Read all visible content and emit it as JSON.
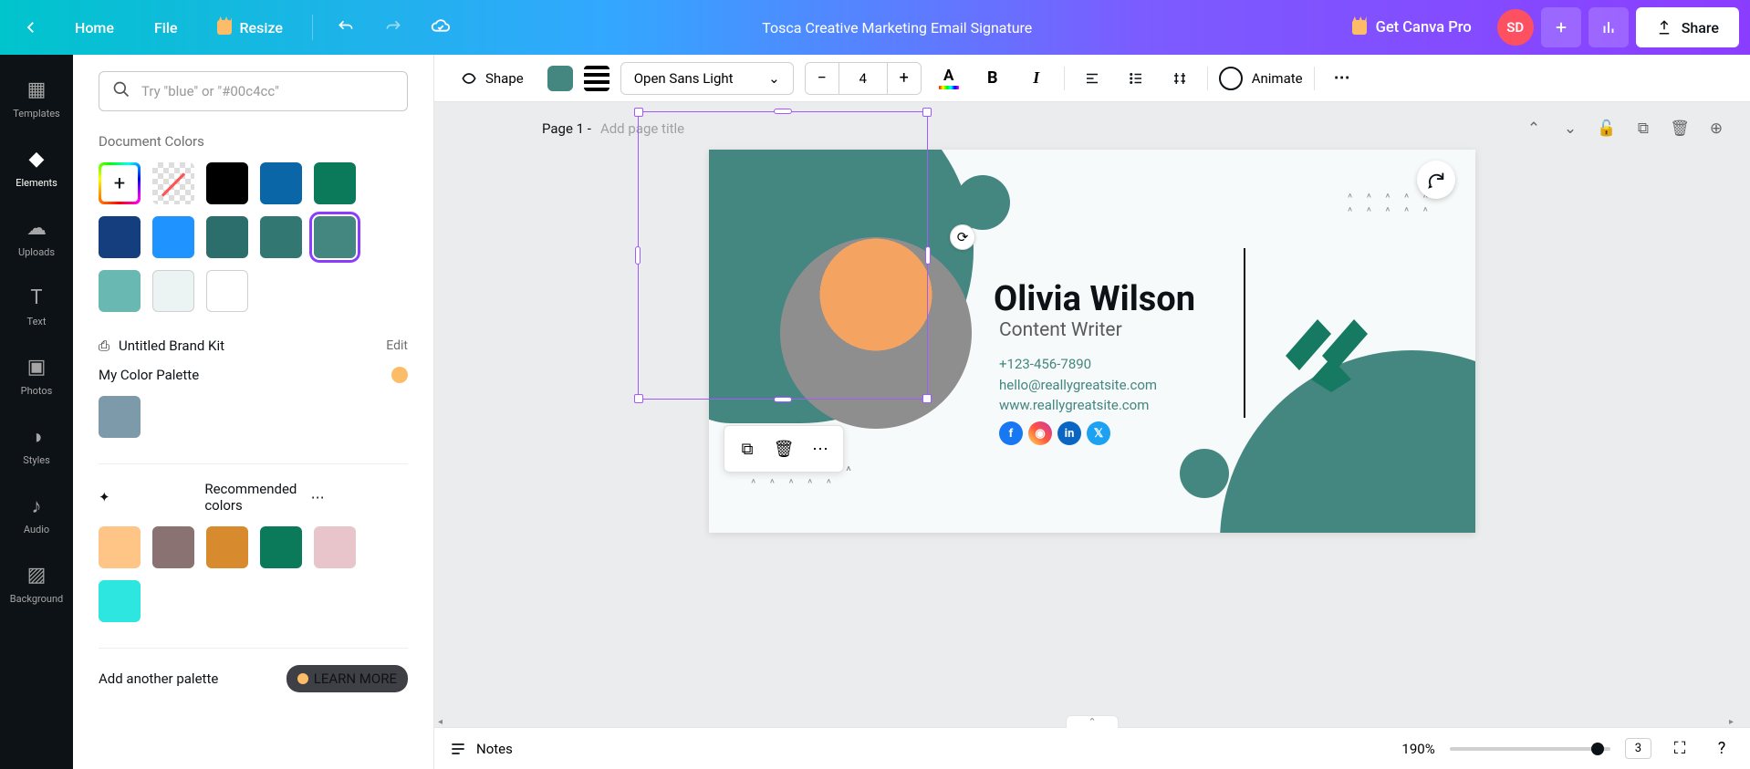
{
  "topbar": {
    "home": "Home",
    "file": "File",
    "resize": "Resize",
    "doc_title": "Tosca Creative Marketing Email Signature",
    "get_pro": "Get Canva Pro",
    "avatar_initials": "SD",
    "share": "Share"
  },
  "rail": [
    {
      "id": "templates",
      "label": "Templates"
    },
    {
      "id": "elements",
      "label": "Elements"
    },
    {
      "id": "uploads",
      "label": "Uploads"
    },
    {
      "id": "text",
      "label": "Text"
    },
    {
      "id": "photos",
      "label": "Photos"
    },
    {
      "id": "styles",
      "label": "Styles"
    },
    {
      "id": "audio",
      "label": "Audio"
    },
    {
      "id": "background",
      "label": "Background"
    }
  ],
  "panel": {
    "search_placeholder": "Try \"blue\" or \"#00c4cc\"",
    "doc_colors_h": "Document Colors",
    "doc_colors": [
      {
        "kind": "add"
      },
      {
        "kind": "none"
      },
      {
        "hex": "#000000"
      },
      {
        "hex": "#0a66a7"
      },
      {
        "hex": "#0a7a5a"
      },
      {
        "hex": "#153e7e"
      },
      {
        "hex": "#1f93ff"
      },
      {
        "hex": "#2c6e6b"
      },
      {
        "hex": "#337773"
      },
      {
        "hex": "#448680",
        "selected": true
      },
      {
        "hex": "#6ab8b2"
      },
      {
        "hex": "#ecf3f3",
        "bordered": true
      },
      {
        "hex": "#ffffff",
        "bordered": true
      }
    ],
    "brand_kit": "Untitled Brand Kit",
    "edit": "Edit",
    "palette_name": "My Color Palette",
    "palette_colors": [
      {
        "hex": "#7d9aab"
      }
    ],
    "rec_h": "Recommended colors",
    "rec_colors": [
      {
        "hex": "#ffc587"
      },
      {
        "hex": "#8a7272"
      },
      {
        "hex": "#d88a2e"
      },
      {
        "hex": "#0b7a5a"
      },
      {
        "hex": "#e7c5ca"
      },
      {
        "hex": "#2ee6e0"
      }
    ],
    "add_palette": "Add another palette",
    "learn_more": "LEARN MORE"
  },
  "ctx": {
    "shape": "Shape",
    "font": "Open Sans Light",
    "font_size": "4",
    "animate": "Animate"
  },
  "page_header": {
    "page_label": "Page 1 -",
    "title_placeholder": "Add page title"
  },
  "design": {
    "name": "Olivia Wilson",
    "role": "Content Writer",
    "phone": "+123-456-7890",
    "email": "hello@reallygreatsite.com",
    "web": "www.reallygreatsite.com",
    "socials": [
      {
        "bg": "#1877f2",
        "txt": "f"
      },
      {
        "bg": "linear-gradient(45deg,#fd5,#ff543e,#c837ab)",
        "txt": "◉"
      },
      {
        "bg": "#0a66c2",
        "txt": "in"
      },
      {
        "bg": "#1da1f2",
        "txt": "𝕏"
      }
    ],
    "chevron_row": "^  ^  ^  ^  ^"
  },
  "bottom": {
    "notes": "Notes",
    "zoom": "190%",
    "zoom_pos_pct": 92,
    "page_count": "3"
  }
}
